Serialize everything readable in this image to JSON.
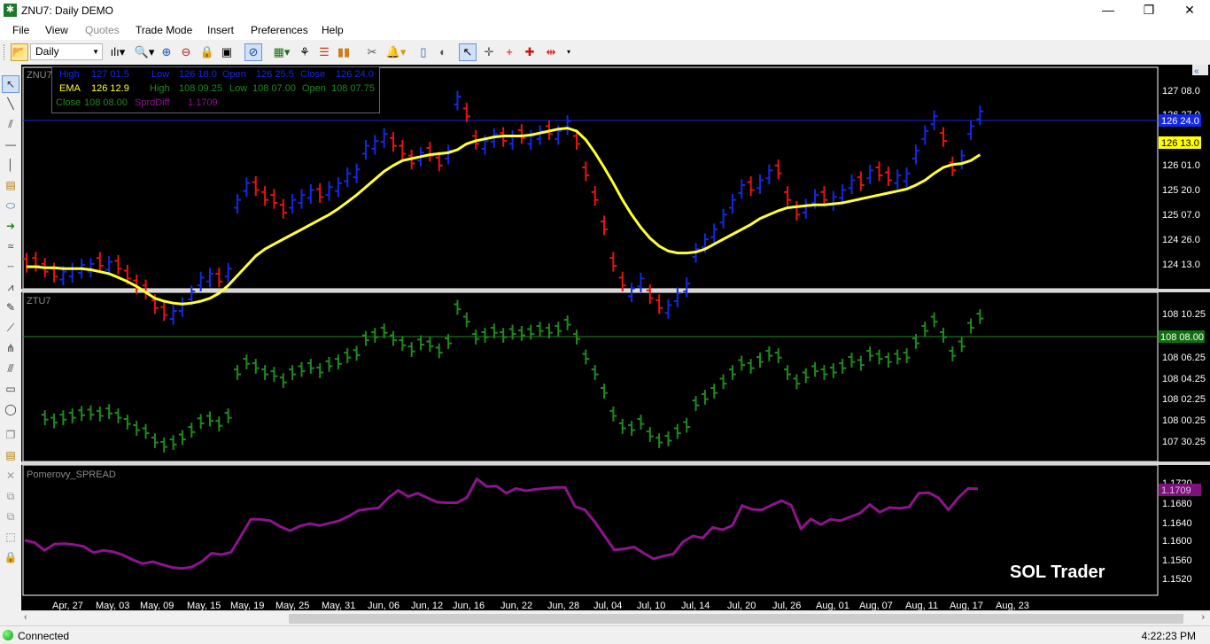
{
  "window": {
    "title": "ZNU7: Daily DEMO",
    "app_icon": "app-icon",
    "controls": [
      "minimize-icon",
      "maximize-icon",
      "close-icon"
    ]
  },
  "menu": [
    "File",
    "View",
    "Quotes",
    "Trade Mode",
    "Insert",
    "Preferences",
    "Help"
  ],
  "toolbar": {
    "period": "Daily",
    "icons": [
      "open-folder-icon",
      "bar-style-icon",
      "zoom-dropdown-icon",
      "zoom-in-icon",
      "zoom-out-icon",
      "lock-icon",
      "fit-icon",
      "crosshair-circle-icon",
      "indicator-icon",
      "tree-icon",
      "color-bars-icon",
      "volume-bars-icon",
      "scissors-icon",
      "bell-icon",
      "phone-icon",
      "mouse-icon",
      "pointer-icon",
      "crosshair-icon",
      "cross-red-icon",
      "target-red-icon",
      "arrow-cross-red-icon",
      "more-icon"
    ]
  },
  "left_tools": [
    "cursor-tool-icon",
    "line-tool-icon",
    "parallel-tool-icon",
    "hline-tool-icon",
    "vline-tool-icon",
    "note-tool-icon",
    "ellipse-tool-icon",
    "arrow-tool-icon",
    "wave-tool-icon",
    "dotted-tool-icon",
    "fib-tool-icon",
    "pen-tool-icon",
    "gann-tool-icon",
    "pitchfork-tool-icon",
    "channel-tool-icon",
    "rect-tool-icon",
    "oval-tool-icon",
    "layers-tool-icon",
    "template-tool-icon",
    "delete-tool-icon",
    "copy-tool-icon",
    "stack-tool-icon",
    "select-tool-icon",
    "lock-tool-icon"
  ],
  "data_window": {
    "row1": {
      "high_label": "High",
      "high": "127 01.5",
      "low_label": "Low",
      "low": "126 18.0",
      "open_label": "Open",
      "open": "126 25.5",
      "close_label": "Close",
      "close": "126 24.0"
    },
    "row2": {
      "ema_label": "EMA",
      "ema": "126 12.9",
      "high_label": "High",
      "high": "108 09.25",
      "low_label": "Low",
      "low": "108 07.00",
      "open_label": "Open",
      "open": "108 07.75"
    },
    "row3": {
      "close_label": "Close",
      "close": "108 08.00",
      "spread_label": "SprdDiff",
      "spread": "1.1709"
    }
  },
  "colors": {
    "up_bar": "#1428e6",
    "down_bar": "#e61414",
    "ema": "#ffff33",
    "ztu_bar": "#1f8a1f",
    "spread_line": "#8e148e",
    "price_tag_znu": "#1428e6",
    "price_tag_ema": "#ffff00",
    "price_tag_ztu": "#107010",
    "price_tag_spread": "#7d127d"
  },
  "chart_data": [
    {
      "type": "ohlc",
      "symbol": "ZNU7",
      "y_ticks": [
        "127 08.0",
        "126 27.0",
        "126 01.0",
        "125 20.0",
        "125 07.0",
        "124 26.0",
        "124 13.0"
      ],
      "last_price_label": "126 24.0",
      "ema_label": "126 13.0",
      "bars": [
        {
          "c": 125.17,
          "dir": "d"
        },
        {
          "c": 125.18,
          "dir": "d"
        },
        {
          "c": 125.12,
          "dir": "d"
        },
        {
          "c": 125.07,
          "dir": "d"
        },
        {
          "c": 125.12,
          "dir": "u"
        },
        {
          "c": 125.15,
          "dir": "u"
        },
        {
          "c": 125.19,
          "dir": "u"
        },
        {
          "c": 125.2,
          "dir": "u"
        },
        {
          "c": 125.18,
          "dir": "d"
        },
        {
          "c": 125.22,
          "dir": "u"
        },
        {
          "c": 125.15,
          "dir": "d"
        },
        {
          "c": 125.05,
          "dir": "d"
        },
        {
          "c": 124.95,
          "dir": "d"
        },
        {
          "c": 124.9,
          "dir": "d"
        },
        {
          "c": 124.75,
          "dir": "d"
        },
        {
          "c": 124.68,
          "dir": "d"
        },
        {
          "c": 124.72,
          "dir": "u"
        },
        {
          "c": 124.8,
          "dir": "u"
        },
        {
          "c": 124.92,
          "dir": "u"
        },
        {
          "c": 125.06,
          "dir": "u"
        },
        {
          "c": 125.1,
          "dir": "u"
        },
        {
          "c": 125.02,
          "dir": "d"
        },
        {
          "c": 125.15,
          "dir": "u"
        },
        {
          "c": 125.85,
          "dir": "u"
        },
        {
          "c": 126.02,
          "dir": "u"
        },
        {
          "c": 125.95,
          "dir": "d"
        },
        {
          "c": 125.85,
          "dir": "d"
        },
        {
          "c": 125.82,
          "dir": "d"
        },
        {
          "c": 125.72,
          "dir": "d"
        },
        {
          "c": 125.85,
          "dir": "u"
        },
        {
          "c": 125.9,
          "dir": "u"
        },
        {
          "c": 125.95,
          "dir": "u"
        },
        {
          "c": 125.88,
          "dir": "d"
        },
        {
          "c": 125.98,
          "dir": "u"
        },
        {
          "c": 126.02,
          "dir": "u"
        },
        {
          "c": 126.12,
          "dir": "u"
        },
        {
          "c": 126.16,
          "dir": "u"
        },
        {
          "c": 126.4,
          "dir": "u"
        },
        {
          "c": 126.45,
          "dir": "u"
        },
        {
          "c": 126.52,
          "dir": "u"
        },
        {
          "c": 126.4,
          "dir": "d"
        },
        {
          "c": 126.32,
          "dir": "d"
        },
        {
          "c": 126.22,
          "dir": "d"
        },
        {
          "c": 126.33,
          "dir": "u"
        },
        {
          "c": 126.3,
          "dir": "d"
        },
        {
          "c": 126.2,
          "dir": "d"
        },
        {
          "c": 126.35,
          "dir": "u"
        },
        {
          "c": 126.9,
          "dir": "u"
        },
        {
          "c": 126.7,
          "dir": "d"
        },
        {
          "c": 126.42,
          "dir": "d"
        },
        {
          "c": 126.45,
          "dir": "u"
        },
        {
          "c": 126.52,
          "dir": "u"
        },
        {
          "c": 126.45,
          "dir": "d"
        },
        {
          "c": 126.5,
          "dir": "u"
        },
        {
          "c": 126.48,
          "dir": "d"
        },
        {
          "c": 126.5,
          "dir": "u"
        },
        {
          "c": 126.55,
          "dir": "u"
        },
        {
          "c": 126.52,
          "dir": "d"
        },
        {
          "c": 126.55,
          "dir": "u"
        },
        {
          "c": 126.65,
          "dir": "u"
        },
        {
          "c": 126.42,
          "dir": "d"
        },
        {
          "c": 126.1,
          "dir": "d"
        },
        {
          "c": 125.85,
          "dir": "d"
        },
        {
          "c": 125.55,
          "dir": "d"
        },
        {
          "c": 125.18,
          "dir": "d"
        },
        {
          "c": 124.98,
          "dir": "d"
        },
        {
          "c": 124.95,
          "dir": "u"
        },
        {
          "c": 125.05,
          "dir": "u"
        },
        {
          "c": 124.85,
          "dir": "d"
        },
        {
          "c": 124.75,
          "dir": "d"
        },
        {
          "c": 124.78,
          "dir": "u"
        },
        {
          "c": 124.9,
          "dir": "u"
        },
        {
          "c": 125.0,
          "dir": "u"
        },
        {
          "c": 125.35,
          "dir": "u"
        },
        {
          "c": 125.45,
          "dir": "u"
        },
        {
          "c": 125.55,
          "dir": "u"
        },
        {
          "c": 125.7,
          "dir": "u"
        },
        {
          "c": 125.85,
          "dir": "u"
        },
        {
          "c": 126.0,
          "dir": "u"
        },
        {
          "c": 125.95,
          "dir": "d"
        },
        {
          "c": 126.05,
          "dir": "u"
        },
        {
          "c": 126.15,
          "dir": "u"
        },
        {
          "c": 126.12,
          "dir": "d"
        },
        {
          "c": 125.85,
          "dir": "d"
        },
        {
          "c": 125.7,
          "dir": "d"
        },
        {
          "c": 125.8,
          "dir": "u"
        },
        {
          "c": 125.9,
          "dir": "u"
        },
        {
          "c": 125.85,
          "dir": "d"
        },
        {
          "c": 125.88,
          "dir": "u"
        },
        {
          "c": 125.95,
          "dir": "u"
        },
        {
          "c": 126.05,
          "dir": "u"
        },
        {
          "c": 126.0,
          "dir": "d"
        },
        {
          "c": 126.15,
          "dir": "u"
        },
        {
          "c": 126.1,
          "dir": "d"
        },
        {
          "c": 126.05,
          "dir": "d"
        },
        {
          "c": 126.1,
          "dir": "u"
        },
        {
          "c": 126.12,
          "dir": "u"
        },
        {
          "c": 126.35,
          "dir": "u"
        },
        {
          "c": 126.55,
          "dir": "u"
        },
        {
          "c": 126.7,
          "dir": "u"
        },
        {
          "c": 126.45,
          "dir": "d"
        },
        {
          "c": 126.15,
          "dir": "d"
        },
        {
          "c": 126.3,
          "dir": "u"
        },
        {
          "c": 126.6,
          "dir": "u"
        },
        {
          "c": 126.75,
          "dir": "u"
        }
      ],
      "ema": [
        125.17,
        125.17,
        125.16,
        125.16,
        125.15,
        125.15,
        125.15,
        125.14,
        125.12,
        125.1,
        125.06,
        125.02,
        124.97,
        124.91,
        124.85,
        124.82,
        124.8,
        124.79,
        124.8,
        124.82,
        124.85,
        124.9,
        124.98,
        125.08,
        125.18,
        125.28,
        125.35,
        125.4,
        125.45,
        125.5,
        125.55,
        125.6,
        125.65,
        125.7,
        125.76,
        125.83,
        125.9,
        125.98,
        126.06,
        126.14,
        126.2,
        126.25,
        126.27,
        126.29,
        126.31,
        126.32,
        126.33,
        126.36,
        126.42,
        126.45,
        126.47,
        126.49,
        126.5,
        126.5,
        126.5,
        126.51,
        126.53,
        126.55,
        126.57,
        126.58,
        126.55,
        126.46,
        126.33,
        126.18,
        126.02,
        125.85,
        125.7,
        125.57,
        125.46,
        125.38,
        125.33,
        125.31,
        125.31,
        125.32,
        125.35,
        125.4,
        125.45,
        125.5,
        125.55,
        125.6,
        125.66,
        125.7,
        125.74,
        125.77,
        125.78,
        125.79,
        125.8,
        125.8,
        125.81,
        125.82,
        125.84,
        125.86,
        125.88,
        125.9,
        125.92,
        125.94,
        125.96,
        126.0,
        126.05,
        126.12,
        126.18,
        126.21,
        126.22,
        126.25,
        126.31
      ]
    },
    {
      "type": "ohlc",
      "symbol": "ZTU7",
      "y_ticks": [
        "108 10.25",
        "108 08.00",
        "108 06.25",
        "108 04.25",
        "108 02.25",
        "108 00.25",
        "107 30.25"
      ],
      "last_price_label": "108 08.00",
      "bars": []
    },
    {
      "type": "line",
      "name": "Pomerovy_SPREAD",
      "y_ticks": [
        "1.1720",
        "1.1680",
        "1.1640",
        "1.1600",
        "1.1560",
        "1.1520"
      ],
      "last_price_label": "1.1709",
      "values": [
        1.1601,
        1.1596,
        1.158,
        1.1593,
        1.1594,
        1.1592,
        1.1588,
        1.1575,
        1.158,
        1.1577,
        1.157,
        1.156,
        1.1552,
        1.1556,
        1.155,
        1.1544,
        1.1542,
        1.1545,
        1.1556,
        1.1574,
        1.1571,
        1.1576,
        1.161,
        1.1645,
        1.1645,
        1.1642,
        1.163,
        1.1621,
        1.1631,
        1.1636,
        1.1632,
        1.1637,
        1.1642,
        1.1652,
        1.1664,
        1.1667,
        1.1669,
        1.169,
        1.1706,
        1.1693,
        1.17,
        1.169,
        1.1681,
        1.168,
        1.168,
        1.1691,
        1.173,
        1.1714,
        1.1715,
        1.17,
        1.171,
        1.1705,
        1.1708,
        1.171,
        1.1712,
        1.1712,
        1.1672,
        1.1665,
        1.164,
        1.161,
        1.1581,
        1.1583,
        1.1587,
        1.1574,
        1.1562,
        1.1568,
        1.1572,
        1.1598,
        1.161,
        1.1606,
        1.1628,
        1.1623,
        1.1632,
        1.1674,
        1.1666,
        1.1665,
        1.1675,
        1.1684,
        1.1675,
        1.1625,
        1.1646,
        1.1634,
        1.1645,
        1.1642,
        1.165,
        1.1658,
        1.1676,
        1.166,
        1.167,
        1.1668,
        1.1671,
        1.17,
        1.1701,
        1.169,
        1.1665,
        1.169,
        1.171,
        1.1709
      ]
    }
  ],
  "x_axis": [
    "Apr, 27",
    "May, 03",
    "May, 09",
    "May, 15",
    "May, 19",
    "May, 25",
    "May, 31",
    "Jun, 06",
    "Jun, 12",
    "Jun, 16",
    "Jun, 22",
    "Jun, 28",
    "Jul, 04",
    "Jul, 10",
    "Jul, 14",
    "Jul, 20",
    "Jul, 26",
    "Aug, 01",
    "Aug, 07",
    "Aug, 11",
    "Aug, 17",
    "Aug, 23"
  ],
  "watermark": "SOL Trader",
  "status": {
    "text": "Connected",
    "time": "4:22:23 PM"
  }
}
